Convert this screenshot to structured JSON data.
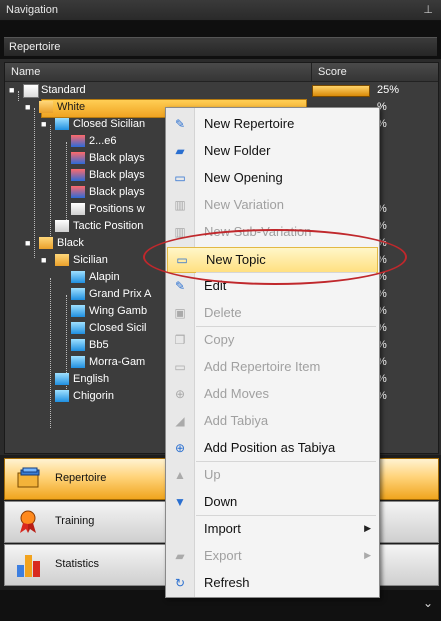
{
  "panel": {
    "title": "Navigation",
    "pin_icon": "pin-icon"
  },
  "tab": {
    "label": "Repertoire"
  },
  "columns": {
    "name": "Name",
    "score": "Score"
  },
  "tree": [
    {
      "label": "Standard",
      "score": "25%",
      "indent": 0,
      "icon": "book-icon"
    },
    {
      "label": "White",
      "score": "%",
      "indent": 1,
      "icon": "folder-icon",
      "selected": true
    },
    {
      "label": "Closed Sicilian",
      "score": "%",
      "indent": 2,
      "icon": "opening-icon"
    },
    {
      "label": "2...e6",
      "indent": 3,
      "icon": "variation-icon"
    },
    {
      "label": "Black plays",
      "indent": 3,
      "icon": "variation-icon"
    },
    {
      "label": "Black plays",
      "indent": 3,
      "icon": "variation-icon"
    },
    {
      "label": "Black plays",
      "indent": 3,
      "icon": "variation-icon"
    },
    {
      "label": "Positions w",
      "score": "%",
      "indent": 3,
      "icon": "positions-icon"
    },
    {
      "label": "Tactic Position",
      "score": "%",
      "indent": 2,
      "icon": "positions-icon"
    },
    {
      "label": "Black",
      "score": "%",
      "indent": 1,
      "icon": "folder-icon"
    },
    {
      "label": "Sicilian",
      "score": "%",
      "indent": 2,
      "icon": "folder-icon"
    },
    {
      "label": "Alapin",
      "score": "%",
      "indent": 3,
      "icon": "opening-icon"
    },
    {
      "label": "Grand Prix A",
      "score": "%",
      "indent": 3,
      "icon": "opening-icon"
    },
    {
      "label": "Wing Gamb",
      "score": "%",
      "indent": 3,
      "icon": "opening-icon"
    },
    {
      "label": "Closed Sicil",
      "score": "%",
      "indent": 3,
      "icon": "opening-icon"
    },
    {
      "label": "Bb5",
      "score": "%",
      "indent": 3,
      "icon": "opening-icon"
    },
    {
      "label": "Morra-Gam",
      "score": "%",
      "indent": 3,
      "icon": "opening-icon"
    },
    {
      "label": "English",
      "score": "%",
      "indent": 2,
      "icon": "opening-icon"
    },
    {
      "label": "Chigorin",
      "score": "%",
      "indent": 2,
      "icon": "opening-icon"
    }
  ],
  "nav_buttons": [
    {
      "label": "Repertoire",
      "icon": "repertoire-icon",
      "active": true
    },
    {
      "label": "Training",
      "icon": "ribbon-icon"
    },
    {
      "label": "Statistics",
      "icon": "bar-chart-icon"
    }
  ],
  "context_menu": {
    "items": [
      {
        "label": "New Repertoire",
        "icon": "new-repertoire-icon"
      },
      {
        "label": "New Folder",
        "icon": "new-folder-icon"
      },
      {
        "label": "New Opening",
        "icon": "new-opening-icon"
      },
      {
        "label": "New Variation",
        "icon": "new-variation-icon",
        "disabled": true
      },
      {
        "label": "New Sub-Variation",
        "icon": "new-subvariation-icon",
        "disabled": true
      },
      {
        "label": "New Topic",
        "icon": "new-topic-icon",
        "hover": true
      },
      {
        "label": "Edit",
        "icon": "edit-icon"
      },
      {
        "label": "Delete",
        "icon": "delete-icon",
        "disabled": true
      },
      {
        "label": "Copy",
        "icon": "copy-icon",
        "disabled": true
      },
      {
        "label": "Add Repertoire Item",
        "icon": "add-item-icon",
        "disabled": true
      },
      {
        "label": "Add Moves",
        "icon": "add-moves-icon",
        "disabled": true
      },
      {
        "label": "Add Tabiya",
        "icon": "add-tabiya-icon",
        "disabled": true
      },
      {
        "label": "Add Position as Tabiya",
        "icon": "add-position-icon"
      },
      {
        "label": "Up",
        "icon": "up-arrow-icon",
        "disabled": true
      },
      {
        "label": "Down",
        "icon": "down-arrow-icon"
      },
      {
        "label": "Import",
        "icon": "import-icon",
        "submenu": true
      },
      {
        "label": "Export",
        "icon": "export-icon",
        "disabled": true,
        "submenu": true
      },
      {
        "label": "Refresh",
        "icon": "refresh-icon"
      }
    ]
  },
  "colors": {
    "accent": "#f0a321",
    "highlight_ring": "#c0282c"
  }
}
